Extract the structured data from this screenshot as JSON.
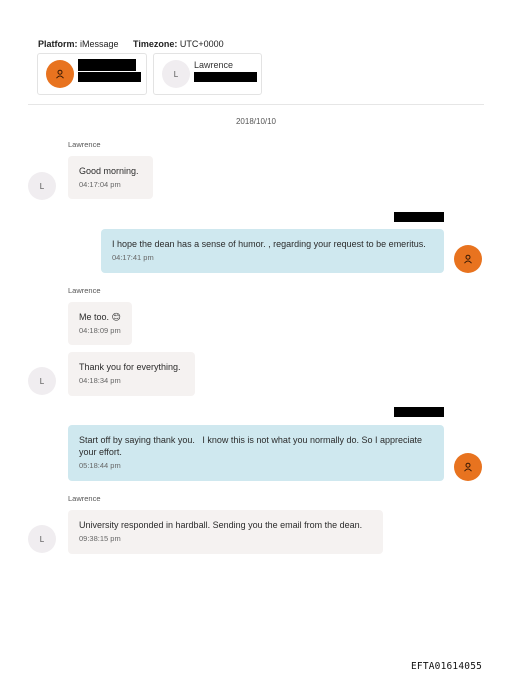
{
  "header": {
    "platform_label": "Platform:",
    "platform_value": "iMessage",
    "timezone_label": "Timezone:",
    "timezone_value": "UTC+0000"
  },
  "participants": [
    {
      "avatar_icon": "person-icon",
      "name_redacted": true
    },
    {
      "initial": "L",
      "name": "Lawrence",
      "detail_redacted": true
    }
  ],
  "date_separator": "2018/10/10",
  "messages": [
    {
      "direction": "incoming",
      "sender": "Lawrence",
      "avatar": "L",
      "text": "Good morning.",
      "time": "04:17:04 pm"
    },
    {
      "direction": "outgoing",
      "sender_redacted": true,
      "avatar_icon": "person-icon",
      "text": "I hope the dean has a sense of humor. , regarding your request to be emeritus.",
      "time": "04:17:41 pm"
    },
    {
      "direction": "incoming",
      "sender": "Lawrence",
      "text": "Me too. 😊",
      "time": "04:18:09 pm"
    },
    {
      "direction": "incoming",
      "avatar": "L",
      "text": "Thank you for everything.",
      "time": "04:18:34 pm"
    },
    {
      "direction": "outgoing",
      "sender_redacted": true,
      "avatar_icon": "person-icon",
      "text": "Start off by saying thank you.   I know this is not what you normally do. So I appreciate your effort.",
      "time": "05:18:44 pm"
    },
    {
      "direction": "incoming",
      "sender": "Lawrence",
      "avatar": "L",
      "text": "University responded in hardball. Sending you the email from the dean.",
      "time": "09:38:15 pm"
    }
  ],
  "footer_id": "EFTA01614055",
  "colors": {
    "accent_orange": "#e8731f",
    "outgoing_bubble": "#cfe8ef",
    "incoming_bubble": "#f5f2f1",
    "redaction": "#000000"
  }
}
